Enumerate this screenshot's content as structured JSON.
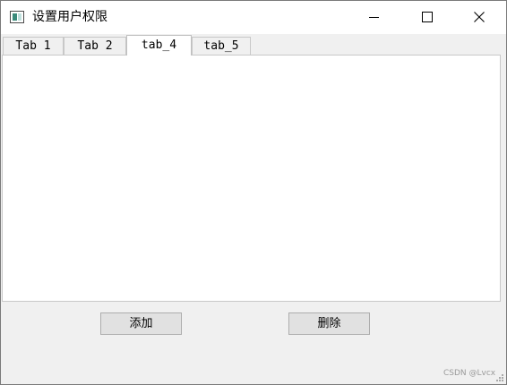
{
  "window": {
    "title": "设置用户权限"
  },
  "titlebar_buttons": {
    "minimize_icon": "minimize-icon",
    "maximize_icon": "maximize-icon",
    "close_icon": "close-icon"
  },
  "tabs": [
    {
      "label": "Tab 1",
      "active": false
    },
    {
      "label": "Tab 2",
      "active": false
    },
    {
      "label": "tab_4",
      "active": true
    },
    {
      "label": "tab_5",
      "active": false
    }
  ],
  "buttons": {
    "add_label": "添加",
    "delete_label": "删除"
  },
  "watermark": "CSDN @Lvcx",
  "colors": {
    "window_bg": "#f0f0f0",
    "titlebar_bg": "#ffffff",
    "content_bg": "#ffffff",
    "button_bg": "#e1e1e1",
    "button_border": "#adadad",
    "watermark_text": "#9a9a9a"
  }
}
